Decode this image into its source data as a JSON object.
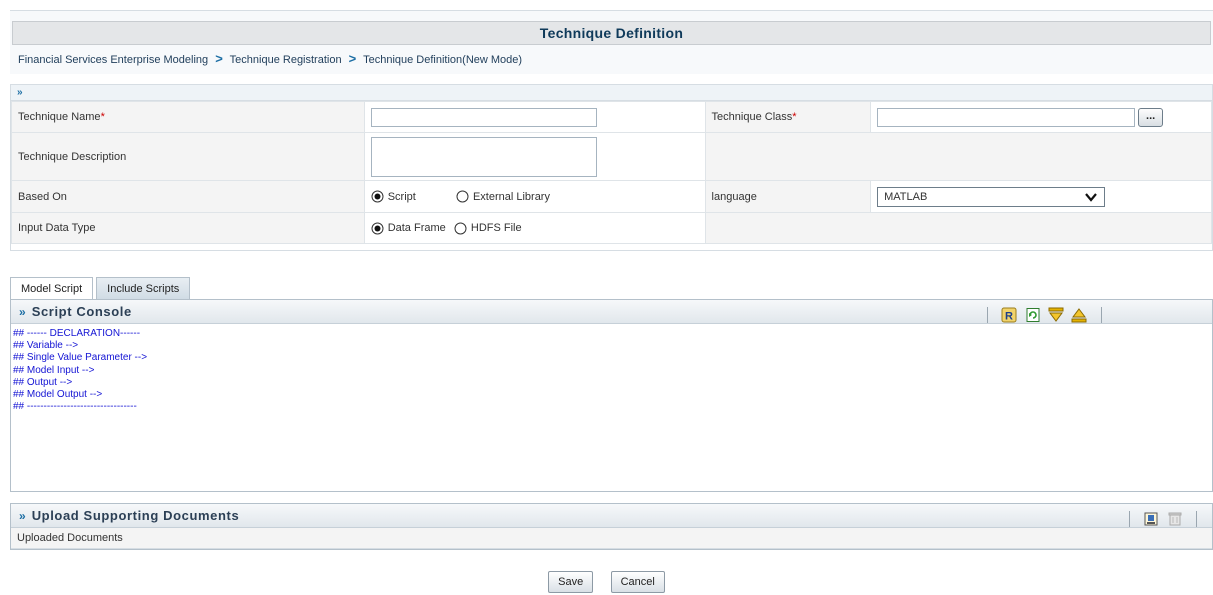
{
  "header": {
    "title": "Technique Definition",
    "breadcrumb": [
      "Financial Services Enterprise Modeling",
      "Technique Registration",
      "Technique Definition(New Mode)"
    ],
    "separator": ">"
  },
  "form": {
    "collapse_icon": "»",
    "technique_name_label": "Technique Name",
    "technique_name_value": "",
    "technique_class_label": "Technique Class",
    "technique_class_value": "",
    "browse_label": "...",
    "technique_description_label": "Technique Description",
    "technique_description_value": "",
    "based_on_label": "Based On",
    "based_on_options": [
      "Script",
      "External Library"
    ],
    "based_on_selected": "Script",
    "language_label": "language",
    "language_value": "MATLAB",
    "input_data_type_label": "Input Data Type",
    "input_data_type_options": [
      "Data Frame",
      "HDFS File"
    ],
    "input_data_type_selected": "Data Frame",
    "required_marker": "*"
  },
  "tabs": [
    {
      "label": "Model Script",
      "active": true
    },
    {
      "label": "Include Scripts",
      "active": false
    }
  ],
  "script_console": {
    "title": "Script Console",
    "chevron": "»",
    "lines": [
      "## ------ DECLARATION------",
      "## Variable -->",
      "## Single Value Parameter -->",
      "## Model Input -->",
      "## Output -->",
      "## Model Output -->",
      "## ---------------------------------"
    ],
    "toolbar_icons": [
      "r-script-icon",
      "refresh-icon",
      "expand-down-icon",
      "collapse-up-icon"
    ]
  },
  "upload": {
    "title": "Upload Supporting Documents",
    "chevron": "»",
    "uploaded_label": "Uploaded Documents",
    "toolbar_icons": [
      "upload-icon",
      "delete-icon"
    ]
  },
  "actions": {
    "save_label": "Save",
    "cancel_label": "Cancel"
  },
  "colors": {
    "accent": "#1c6ea4",
    "required": "#cc0000",
    "script_text": "#1414d4"
  }
}
